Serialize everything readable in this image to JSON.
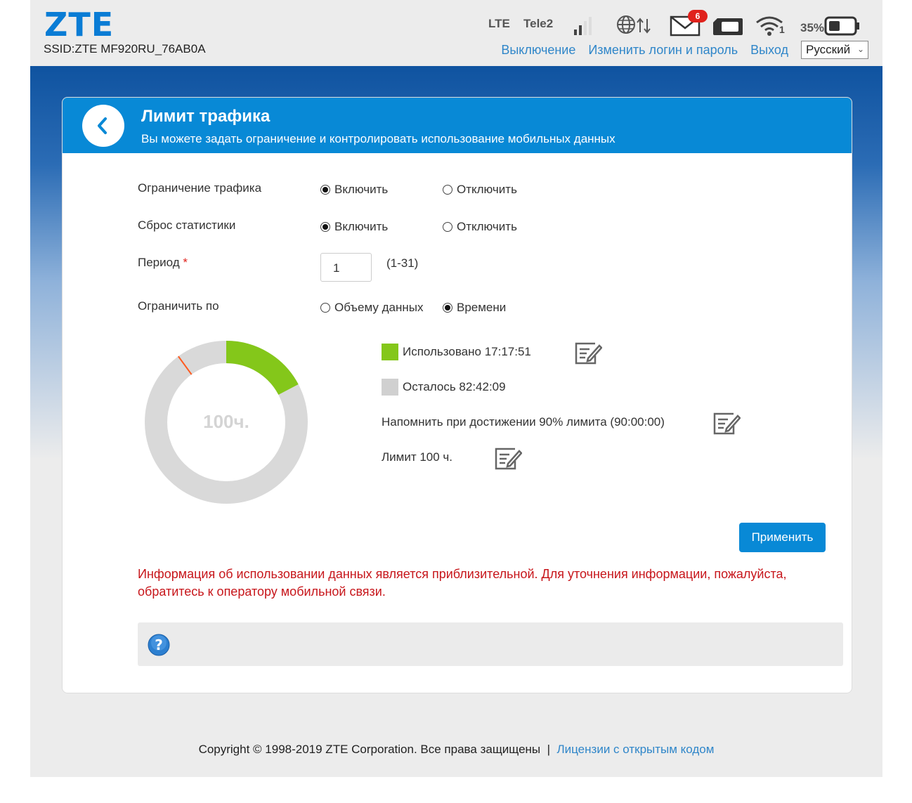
{
  "header": {
    "logo": "ZTE",
    "ssid": "SSID:ZTE MF920RU_76AB0A",
    "network_type": "LTE",
    "operator": "Tele2",
    "sms_count": "6",
    "battery_percent": "35%",
    "wifi_clients": "1",
    "nav": {
      "shutdown": "Выключение",
      "change_login": "Изменить логин и пароль",
      "logout": "Выход"
    },
    "language": "Русский"
  },
  "card": {
    "title": "Лимит трафика",
    "subtitle": "Вы можете задать ограничение и контролировать использование мобильных данных"
  },
  "form": {
    "traffic_limit": {
      "label": "Ограничение трафика",
      "on": "Включить",
      "off": "Отключить",
      "selected": "on"
    },
    "reset_stats": {
      "label": "Сброс статистики",
      "on": "Включить",
      "off": "Отключить",
      "selected": "on"
    },
    "period": {
      "label": "Период",
      "required_mark": "*",
      "value": "1",
      "range": "(1-31)"
    },
    "limit_by": {
      "label": "Ограничить по",
      "by_data": "Объему данных",
      "by_time": "Времени",
      "selected": "time"
    }
  },
  "usage": {
    "center_label": "100ч.",
    "used_label": "Использовано 17:17:51",
    "remaining_label": "Осталось 82:42:09",
    "reminder_label": "Напомнить при достижении 90% лимита (90:00:00)",
    "limit_label": "Лимит 100 ч.",
    "used_fraction": 0.173,
    "reminder_fraction": 0.9,
    "colors": {
      "used": "#84c71a",
      "remaining": "#d9d9d9",
      "reminder_mark": "#ff5a1f"
    }
  },
  "apply_button": "Применить",
  "warning": "Информация об использовании данных является приблизительной. Для уточнения информации, пожалуйста, обратитесь к оператору мобильной связи.",
  "footer": {
    "copyright": "Copyright © 1998-2019 ZTE Corporation. Все права защищены",
    "separator": "|",
    "licenses_link": "Лицензии с открытым кодом"
  }
}
